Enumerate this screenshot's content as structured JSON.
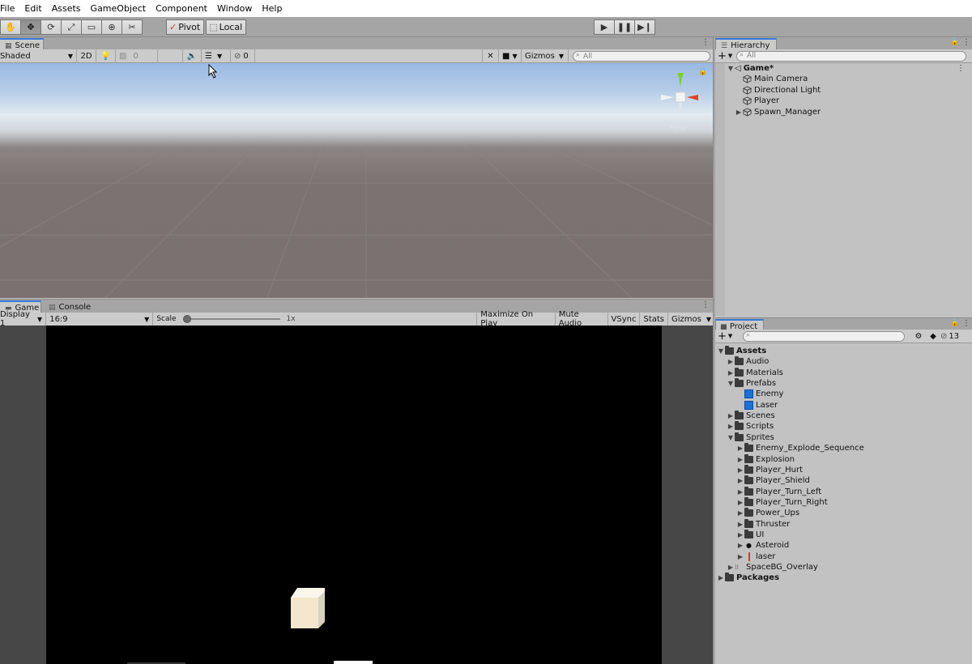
{
  "menu": [
    "File",
    "Edit",
    "Assets",
    "GameObject",
    "Component",
    "Window",
    "Help"
  ],
  "toolbar": {
    "tools": [
      "hand-tool",
      "move-tool",
      "rotate-tool",
      "scale-tool",
      "rect-tool",
      "transform-tool",
      "custom-tool"
    ],
    "active_tool": "move-tool",
    "pivot_label": "Pivot",
    "local_label": "Local",
    "play_controls": [
      "play",
      "pause",
      "step"
    ]
  },
  "scene": {
    "tab_label": "Scene",
    "shading_mode": "Shaded",
    "mode_2d_label": "2D",
    "effects_value": "0",
    "hidden_count": "0",
    "gizmos_label": "Gizmos",
    "search_placeholder": "All",
    "gizmo_label": "Persp"
  },
  "game": {
    "tabs": [
      "Game",
      "Console"
    ],
    "display_label": "Display 1",
    "aspect_label": "16:9",
    "scale_label": "Scale",
    "scale_value": "1x",
    "scale_fraction": 0.0,
    "buttons": [
      "Maximize On Play",
      "Mute Audio",
      "VSync",
      "Stats",
      "Gizmos"
    ]
  },
  "hierarchy": {
    "tab_label": "Hierarchy",
    "search_placeholder": "All",
    "scene_name": "Game*",
    "items": [
      {
        "name": "Main Camera",
        "expandable": false
      },
      {
        "name": "Directional Light",
        "expandable": false
      },
      {
        "name": "Player",
        "expandable": false
      },
      {
        "name": "Spawn_Manager",
        "expandable": true
      }
    ]
  },
  "project": {
    "tab_label": "Project",
    "badge_count": "13",
    "tree": [
      {
        "name": "Assets",
        "depth": 0,
        "arrow": "down",
        "icon": "folder",
        "bold": true
      },
      {
        "name": "Audio",
        "depth": 1,
        "arrow": "right",
        "icon": "folder"
      },
      {
        "name": "Materials",
        "depth": 1,
        "arrow": "right",
        "icon": "folder"
      },
      {
        "name": "Prefabs",
        "depth": 1,
        "arrow": "down",
        "icon": "folder"
      },
      {
        "name": "Enemy",
        "depth": 2,
        "arrow": "none",
        "icon": "prefab"
      },
      {
        "name": "Laser",
        "depth": 2,
        "arrow": "none",
        "icon": "prefab"
      },
      {
        "name": "Scenes",
        "depth": 1,
        "arrow": "right",
        "icon": "folder"
      },
      {
        "name": "Scripts",
        "depth": 1,
        "arrow": "right",
        "icon": "folder"
      },
      {
        "name": "Sprites",
        "depth": 1,
        "arrow": "down",
        "icon": "folder"
      },
      {
        "name": "Enemy_Explode_Sequence",
        "depth": 2,
        "arrow": "right",
        "icon": "folder"
      },
      {
        "name": "Explosion",
        "depth": 2,
        "arrow": "right",
        "icon": "folder"
      },
      {
        "name": "Player_Hurt",
        "depth": 2,
        "arrow": "right",
        "icon": "folder"
      },
      {
        "name": "Player_Shield",
        "depth": 2,
        "arrow": "right",
        "icon": "folder"
      },
      {
        "name": "Player_Turn_Left",
        "depth": 2,
        "arrow": "right",
        "icon": "folder"
      },
      {
        "name": "Player_Turn_Right",
        "depth": 2,
        "arrow": "right",
        "icon": "folder"
      },
      {
        "name": "Power_Ups",
        "depth": 2,
        "arrow": "right",
        "icon": "folder"
      },
      {
        "name": "Thruster",
        "depth": 2,
        "arrow": "right",
        "icon": "folder"
      },
      {
        "name": "UI",
        "depth": 2,
        "arrow": "right",
        "icon": "folder"
      },
      {
        "name": "Asteroid",
        "depth": 2,
        "arrow": "right",
        "icon": "sprite-dot"
      },
      {
        "name": "laser",
        "depth": 2,
        "arrow": "right",
        "icon": "sprite-laser"
      },
      {
        "name": "SpaceBG_Overlay",
        "depth": 1,
        "arrow": "right",
        "icon": "sprite-image"
      },
      {
        "name": "Packages",
        "depth": 0,
        "arrow": "right",
        "icon": "folder",
        "bold": true
      }
    ]
  }
}
